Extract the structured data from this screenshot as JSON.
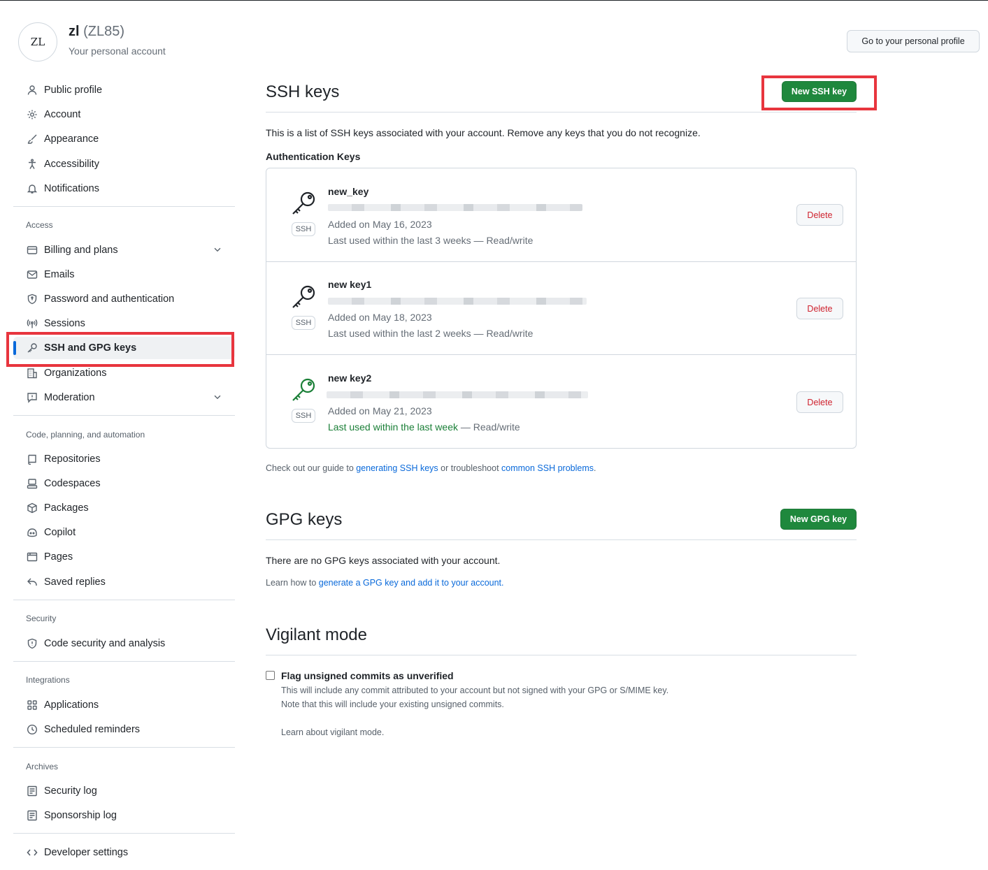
{
  "header": {
    "avatar_text": "ZL",
    "name": "zl",
    "login": "(ZL85)",
    "subtitle": "Your personal account",
    "profile_button": "Go to your personal profile"
  },
  "sidebar": {
    "items": [
      {
        "label": "Public profile",
        "icon": "person-icon"
      },
      {
        "label": "Account",
        "icon": "gear-icon"
      },
      {
        "label": "Appearance",
        "icon": "paintbrush-icon"
      },
      {
        "label": "Accessibility",
        "icon": "accessibility-icon"
      },
      {
        "label": "Notifications",
        "icon": "bell-icon"
      }
    ],
    "access_heading": "Access",
    "access_items": [
      {
        "label": "Billing and plans",
        "icon": "credit-card-icon"
      },
      {
        "label": "Emails",
        "icon": "mail-icon"
      },
      {
        "label": "Password and authentication",
        "icon": "shield-lock-icon"
      },
      {
        "label": "Sessions",
        "icon": "broadcast-icon"
      },
      {
        "label": "SSH and GPG keys",
        "icon": "key-icon"
      },
      {
        "label": "Organizations",
        "icon": "organization-icon"
      },
      {
        "label": "Moderation",
        "icon": "report-icon"
      }
    ],
    "code_heading": "Code, planning, and automation",
    "code_items": [
      {
        "label": "Repositories",
        "icon": "repo-icon"
      },
      {
        "label": "Codespaces",
        "icon": "codespaces-icon"
      },
      {
        "label": "Packages",
        "icon": "package-icon"
      },
      {
        "label": "Copilot",
        "icon": "copilot-icon"
      },
      {
        "label": "Pages",
        "icon": "browser-icon"
      },
      {
        "label": "Saved replies",
        "icon": "reply-icon"
      }
    ],
    "security_heading": "Security",
    "security_items": [
      {
        "label": "Code security and analysis",
        "icon": "shield-icon"
      }
    ],
    "integrations_heading": "Integrations",
    "integrations_items": [
      {
        "label": "Applications",
        "icon": "apps-icon"
      },
      {
        "label": "Scheduled reminders",
        "icon": "clock-icon"
      }
    ],
    "archives_heading": "Archives",
    "archives_items": [
      {
        "label": "Security log",
        "icon": "log-icon"
      },
      {
        "label": "Sponsorship log",
        "icon": "log-icon"
      }
    ],
    "developer_settings": "Developer settings"
  },
  "ssh": {
    "title": "SSH keys",
    "new_button": "New SSH key",
    "description": "This is a list of SSH keys associated with your account. Remove any keys that you do not recognize.",
    "auth_heading": "Authentication Keys",
    "keys": [
      {
        "name": "new_key",
        "type": "SSH",
        "added": "Added on May 16, 2023",
        "used_prefix": "Last used within the last 3 weeks",
        "used_suffix": " — Read/write",
        "delete": "Delete"
      },
      {
        "name": "new key1",
        "type": "SSH",
        "added": "Added on May 18, 2023",
        "used_prefix": "Last used within the last 2 weeks",
        "used_suffix": " — Read/write",
        "delete": "Delete"
      },
      {
        "name": "new key2",
        "type": "SSH",
        "added": "Added on May 21, 2023",
        "used_prefix": "Last used within the last week",
        "used_suffix": " — Read/write",
        "delete": "Delete"
      }
    ],
    "guide_prefix": "Check out our guide to ",
    "guide_link1": "generating SSH keys",
    "guide_middle": " or troubleshoot ",
    "guide_link2": "common SSH problems",
    "guide_suffix": "."
  },
  "gpg": {
    "title": "GPG keys",
    "new_button": "New GPG key",
    "empty_text": "There are no GPG keys associated with your account.",
    "learn_prefix": "Learn how to ",
    "learn_link": "generate a GPG key and add it to your account",
    "learn_suffix": "."
  },
  "vigilant": {
    "title": "Vigilant mode",
    "checkbox_label": "Flag unsigned commits as unverified",
    "desc1": "This will include any commit attributed to your account but not signed with your GPG or S/MIME key.",
    "desc2": "Note that this will include your existing unsigned commits.",
    "learn_link": "Learn about vigilant mode."
  },
  "colors": {
    "primary_button": "#1f883d",
    "link": "#0969da",
    "danger": "#cf222e",
    "highlight_box": "#e8353e",
    "active_indicator": "#0969da"
  }
}
